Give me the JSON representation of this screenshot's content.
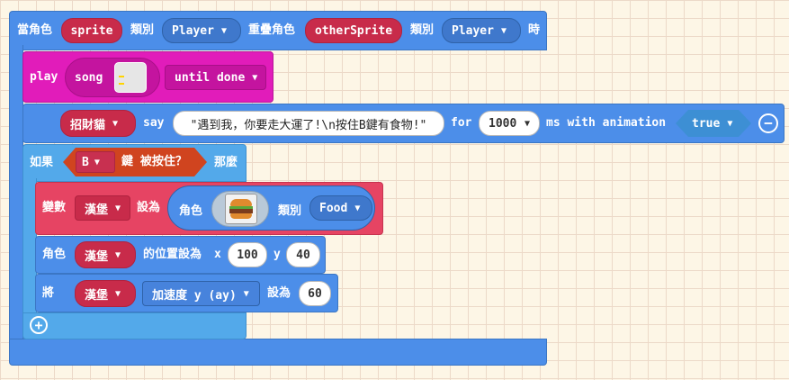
{
  "event_block": {
    "prefix": "當角色",
    "sprite": "sprite",
    "kind_label_1": "類別",
    "kind_1": "Player",
    "overlap_label": "重疊角色",
    "other_sprite": "otherSprite",
    "kind_label_2": "類別",
    "kind_2": "Player",
    "suffix": "時"
  },
  "play_block": {
    "play": "play",
    "song": "song",
    "mode": "until done"
  },
  "say_block": {
    "sprite": "招財貓",
    "say": "say",
    "text": "\"遇到我，你要走大運了!\\n按住B鍵有食物!\"",
    "for": "for",
    "duration": "1000",
    "unit": "ms with animation",
    "animation": "true"
  },
  "if_block": {
    "if_label": "如果",
    "key": "B",
    "pressed": "鍵 被按住？",
    "then": "那麼"
  },
  "set_var_block": {
    "label": "變數",
    "variable": "漢堡",
    "set_to": "設為",
    "sprite_label": "角色",
    "kind_label": "類別",
    "kind": "Food"
  },
  "position_block": {
    "label": "角色",
    "sprite": "漢堡",
    "set_pos": "的位置設為",
    "x_label": "x",
    "x": "100",
    "y_label": "y",
    "y": "40"
  },
  "accel_block": {
    "label": "將",
    "sprite": "漢堡",
    "property": "加速度 y (ay)",
    "set_to": "設為",
    "value": "60"
  },
  "colors": {
    "event_blue": "#4c8ee9",
    "logic_blue": "#53a9ea",
    "music_magenta": "#e11cba",
    "sprite_red": "#e64463",
    "hex_orange": "#d0441f"
  },
  "icons": {
    "music_icon": "music-note-icon",
    "burger_icon": "burger-icon",
    "remove_icon": "minus-circle-icon",
    "add_icon": "plus-circle-icon"
  }
}
